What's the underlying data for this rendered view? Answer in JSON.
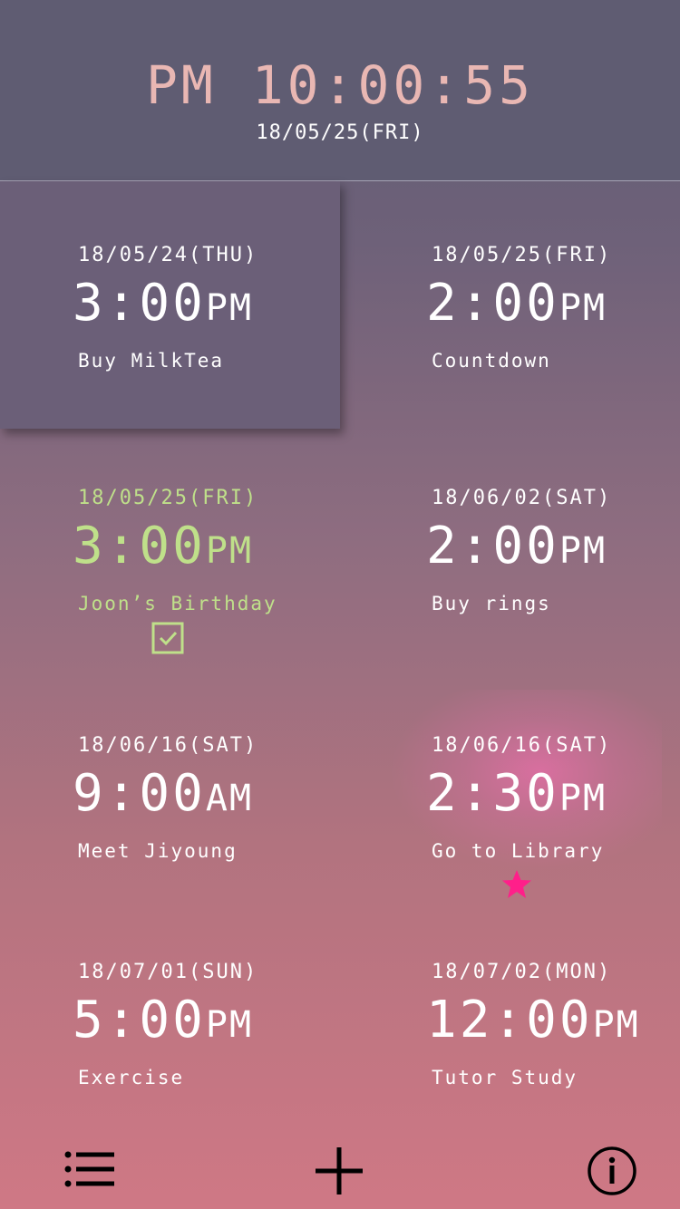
{
  "header": {
    "clock": "PM 10:00:55",
    "date": "18/05/25(FRI)"
  },
  "events": [
    {
      "date": "18/05/24(THU)",
      "time": "3:00",
      "ampm": "PM",
      "title": "Buy MilkTea",
      "selected": true
    },
    {
      "date": "18/05/25(FRI)",
      "time": "2:00",
      "ampm": "PM",
      "title": "Countdown"
    },
    {
      "date": "18/05/25(FRI)",
      "time": "3:00",
      "ampm": "PM",
      "title": "Joon’s Birthday",
      "completed": true
    },
    {
      "date": "18/06/02(SAT)",
      "time": "2:00",
      "ampm": "PM",
      "title": "Buy rings"
    },
    {
      "date": "18/06/16(SAT)",
      "time": "9:00",
      "ampm": "AM",
      "title": "Meet Jiyoung"
    },
    {
      "date": "18/06/16(SAT)",
      "time": "2:30",
      "ampm": "PM",
      "title": "Go to Library",
      "starred": true
    },
    {
      "date": "18/07/01(SUN)",
      "time": "5:00",
      "ampm": "PM",
      "title": "Exercise"
    },
    {
      "date": "18/07/02(MON)",
      "time": "12:00",
      "ampm": "PM",
      "title": "Tutor Study"
    }
  ],
  "toolbar": {
    "list_icon": "list-icon",
    "add_icon": "plus-icon",
    "info_icon": "info-icon"
  },
  "colors": {
    "header_bg": "#5f5c72",
    "clock_text": "#e9b7b3",
    "completed": "#bfe08a",
    "star": "#ff1f8a"
  }
}
